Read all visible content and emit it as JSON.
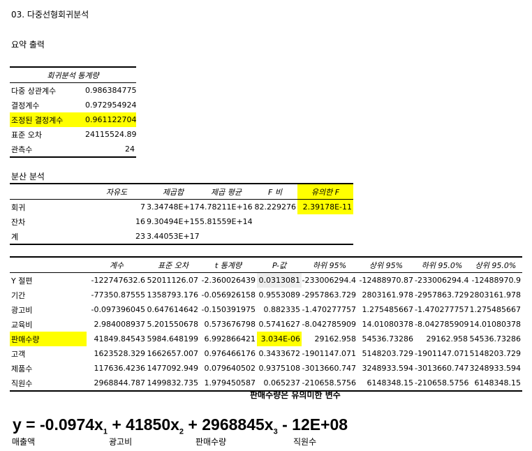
{
  "title": "03. 다중선형회귀분석",
  "summary_heading": "요약 출력",
  "regression_stats": {
    "header": "회귀분석 통계량",
    "rows": [
      {
        "label": "다중 상관계수",
        "value": "0.986384775",
        "highlight": false
      },
      {
        "label": "결정계수",
        "value": "0.972954924",
        "highlight": false
      },
      {
        "label": "조정된 결정계수",
        "value": "0.961122704",
        "highlight": true
      },
      {
        "label": "표준 오차",
        "value": "24115524.89",
        "highlight": false
      },
      {
        "label": "관측수",
        "value": "24",
        "highlight": false
      }
    ]
  },
  "anova_heading": "분산 분석",
  "anova": {
    "headers": [
      "",
      "자유도",
      "제곱합",
      "제곱 평균",
      "F 비",
      "유의한 F"
    ],
    "rows": [
      [
        "회귀",
        "7",
        "3.34748E+17",
        "4.78211E+16",
        "82.229276",
        "2.39178E-11"
      ],
      [
        "잔차",
        "16",
        "9.30494E+15",
        "5.81559E+14",
        "",
        ""
      ],
      [
        "계",
        "23",
        "3.44053E+17",
        "",
        "",
        ""
      ]
    ]
  },
  "coefficients": {
    "headers": [
      "",
      "계수",
      "표준 오차",
      "t 통계량",
      "P-값",
      "하위 95%",
      "상위 95%",
      "하위 95.0%",
      "상위 95.0%"
    ],
    "rows": [
      [
        "Y 절편",
        "-122747632.6",
        "52011126.07",
        "-2.360026439",
        "0.0313081",
        "-233006294.4",
        "-12488970.87",
        "-233006294.4",
        "-12488970.9"
      ],
      [
        "기간",
        "-77350.87555",
        "1358793.176",
        "-0.056926158",
        "0.9553089",
        "-2957863.729",
        "2803161.978",
        "-2957863.729",
        "2803161.978"
      ],
      [
        "광고비",
        "-0.097396045",
        "0.647614642",
        "-0.150391975",
        "0.882335",
        "-1.470277757",
        "1.275485667",
        "-1.470277757",
        "1.275485667"
      ],
      [
        "교육비",
        "2.984008937",
        "5.201550678",
        "0.573676798",
        "0.5741627",
        "-8.042785909",
        "14.01080378",
        "-8.042785909",
        "14.01080378"
      ],
      [
        "판매수량",
        "41849.84543",
        "5984.648199",
        "6.992866421",
        "3.034E-06",
        "29162.958",
        "54536.73286",
        "29162.958",
        "54536.73286"
      ],
      [
        "고객",
        "1623528.329",
        "1662657.007",
        "0.976466176",
        "0.3433672",
        "-1901147.071",
        "5148203.729",
        "-1901147.071",
        "5148203.729"
      ],
      [
        "제품수",
        "117636.4236",
        "1477092.949",
        "0.079640502",
        "0.9375108",
        "-3013660.747",
        "3248933.594",
        "-3013660.747",
        "3248933.594"
      ],
      [
        "직원수",
        "2968844.787",
        "1499832.735",
        "1.979450587",
        "0.065237",
        "-210658.5756",
        "6148348.15",
        "-210658.5756",
        "6148348.15"
      ]
    ]
  },
  "note": "판매수량은 유의미한 변수",
  "equation": {
    "lhs": "y",
    "eq": " = ",
    "t1": "-0.0974x",
    "s1": "1",
    "t2": " + 41850x",
    "s2": "2",
    "t3": " + 2968845x",
    "s3": "3",
    "t4": " - 12E+08",
    "labels": [
      "매출액",
      "광고비",
      "판매수량",
      "직원수"
    ]
  },
  "colors": {
    "highlight": "#ffff00",
    "pvalue_shade": "#eeeeee"
  }
}
